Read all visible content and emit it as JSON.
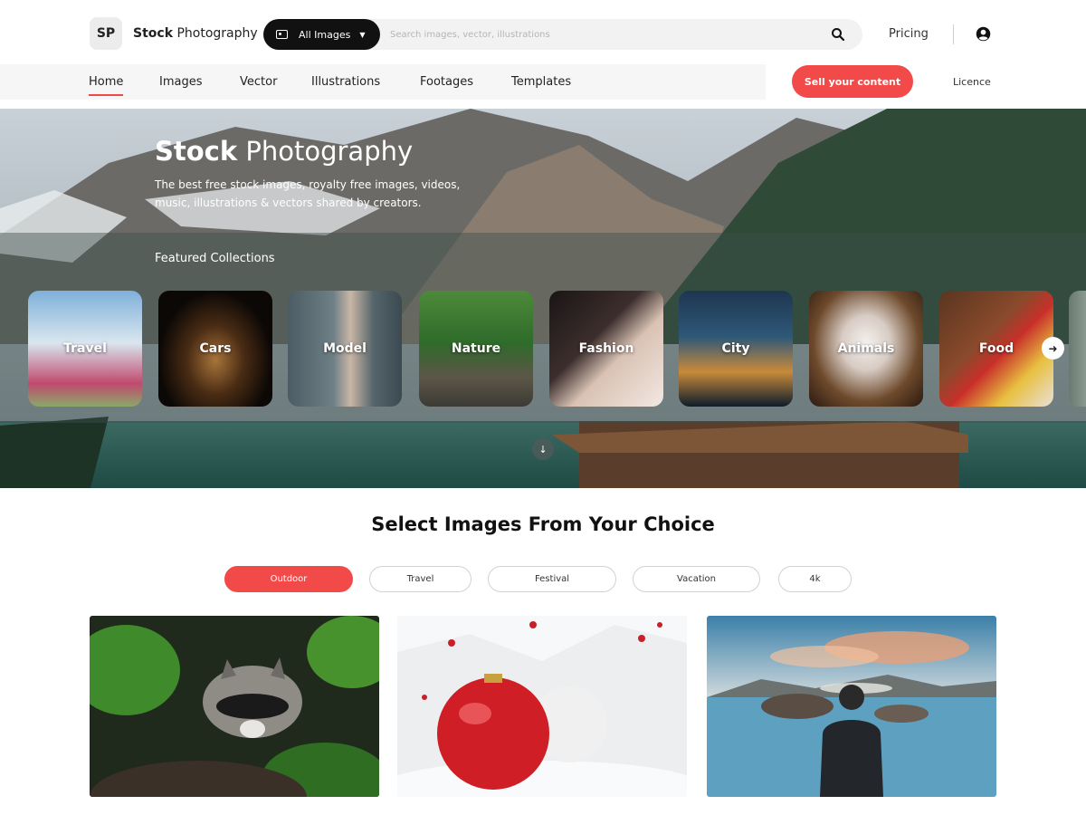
{
  "header": {
    "logo_text": "SP",
    "brand_bold": "Stock",
    "brand_rest": " Photography",
    "search": {
      "type_label": "All Images",
      "placeholder": "Search images, vector, illustrations",
      "value": ""
    },
    "pricing_label": "Pricing"
  },
  "nav": {
    "items": [
      {
        "label": "Home",
        "active": true
      },
      {
        "label": "Images"
      },
      {
        "label": "Vector"
      },
      {
        "label": "Illustrations"
      },
      {
        "label": "Footages"
      },
      {
        "label": "Templates"
      }
    ],
    "sell_label": "Sell your content",
    "licence_label": "Licence"
  },
  "hero": {
    "title_bold": "Stock",
    "title_rest": " Photography",
    "subtitle": "The best free stock images, royalty free images, videos, music, illustrations & vectors shared by creators.",
    "featured_label": "Featured Collections",
    "collections": [
      {
        "label": "Travel"
      },
      {
        "label": "Cars"
      },
      {
        "label": "Model"
      },
      {
        "label": "Nature"
      },
      {
        "label": "Fashion"
      },
      {
        "label": "City"
      },
      {
        "label": "Animals"
      },
      {
        "label": "Food"
      }
    ]
  },
  "choice": {
    "title": "Select Images From Your Choice",
    "filters": [
      {
        "label": "Outdoor",
        "active": true
      },
      {
        "label": "Travel"
      },
      {
        "label": "Festival"
      },
      {
        "label": "Vacation"
      },
      {
        "label": "4k"
      }
    ]
  },
  "colors": {
    "accent": "#f24949",
    "dark": "#111111"
  }
}
